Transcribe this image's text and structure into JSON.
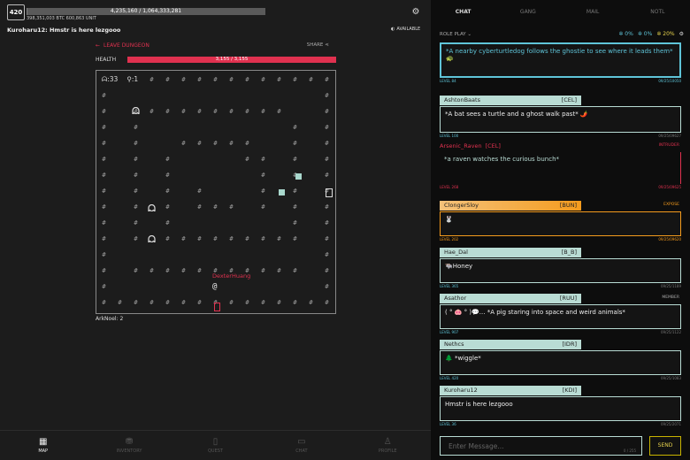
{
  "player": {
    "level": "420",
    "xp_text": "4,235,160 / 1,064,333,281",
    "xp_fraction": 0.004,
    "btc_text": "398,351,003 BTC   600,863 UNIT"
  },
  "status": {
    "line": "Kuroharu12: Hmstr is here lezgooo",
    "available": "AVAILABLE"
  },
  "dungeon": {
    "leave": "LEAVE DUNGEON",
    "share": "SHARE",
    "health_label": "HEALTH",
    "health_text": "3,155 / 3,155",
    "health_fraction": 1.0,
    "ghost_count": "33",
    "player_count": "1",
    "player_name": "DexterHuang",
    "player_symbol": "@",
    "wall_symbol": "#",
    "footer_user": "ArkNoel: 2"
  },
  "nav": [
    {
      "label": "MAP",
      "icon": "map-icon",
      "active": true
    },
    {
      "label": "INVENTORY",
      "icon": "trash-icon",
      "active": false
    },
    {
      "label": "QUEST",
      "icon": "phone-icon",
      "active": false
    },
    {
      "label": "CHAT",
      "icon": "chat-icon",
      "active": false
    },
    {
      "label": "PROFILE",
      "icon": "user-icon",
      "active": false
    }
  ],
  "chat": {
    "tabs": [
      "CHAT",
      "GANG",
      "MAIL",
      "NOTL"
    ],
    "roleplay": "ROLE PLAY ⌄",
    "stats": [
      "0%",
      "0%",
      "20%"
    ],
    "messages": [
      {
        "text": "*A nearby cyberturtledog follows the ghostie to see where it leads them*🐢",
        "level": "LEVEL 84",
        "date": "09/25/10050",
        "style": "cyan"
      },
      {
        "name": "AshtonBaats",
        "clan": "[CEL]",
        "text": "*A bat sees a turtle and a ghost walk past* 🌶️",
        "level": "LEVEL 100",
        "date": "09/25/09627"
      },
      {
        "name": "Arsenic_Raven",
        "clan": "[CEL]",
        "tag": "INTRUDER",
        "text": "*a raven watches the curious bunch*",
        "level": "LEVEL 268",
        "date": "09/25/09625",
        "style": "red"
      },
      {
        "name": "ClongerSloy",
        "clan": "[BUN]",
        "tag": "EXPOSE",
        "text": "🐰",
        "level": "LEVEL 202",
        "date": "09/25/09620",
        "style": "orange"
      },
      {
        "name": "Hae_Dal",
        "clan": "[B_B]",
        "text": "🐃Honey",
        "level": "LEVEL 365",
        "date": "09/25/1189"
      },
      {
        "name": "Asathor",
        "clan": "[RUU]",
        "tag": "MEMBER",
        "text": "( ° 🐽 ° )💬... *A pig staring into space and weird animals*",
        "level": "LEVEL 907",
        "date": "09/25/1122"
      },
      {
        "name": "Nethcs",
        "clan": "[IDR]",
        "text": "🌲 *wiggle*",
        "level": "LEVEL 420",
        "date": "09/25/1083"
      },
      {
        "name": "Kuroharu12",
        "clan": "[KDI]",
        "text": "Hmstr is here lezgooo",
        "level": "LEVEL 36",
        "date": "09/25/2071"
      }
    ],
    "compose_placeholder": "Enter Message...",
    "char_count": "0 / 255",
    "send": "SEND"
  }
}
